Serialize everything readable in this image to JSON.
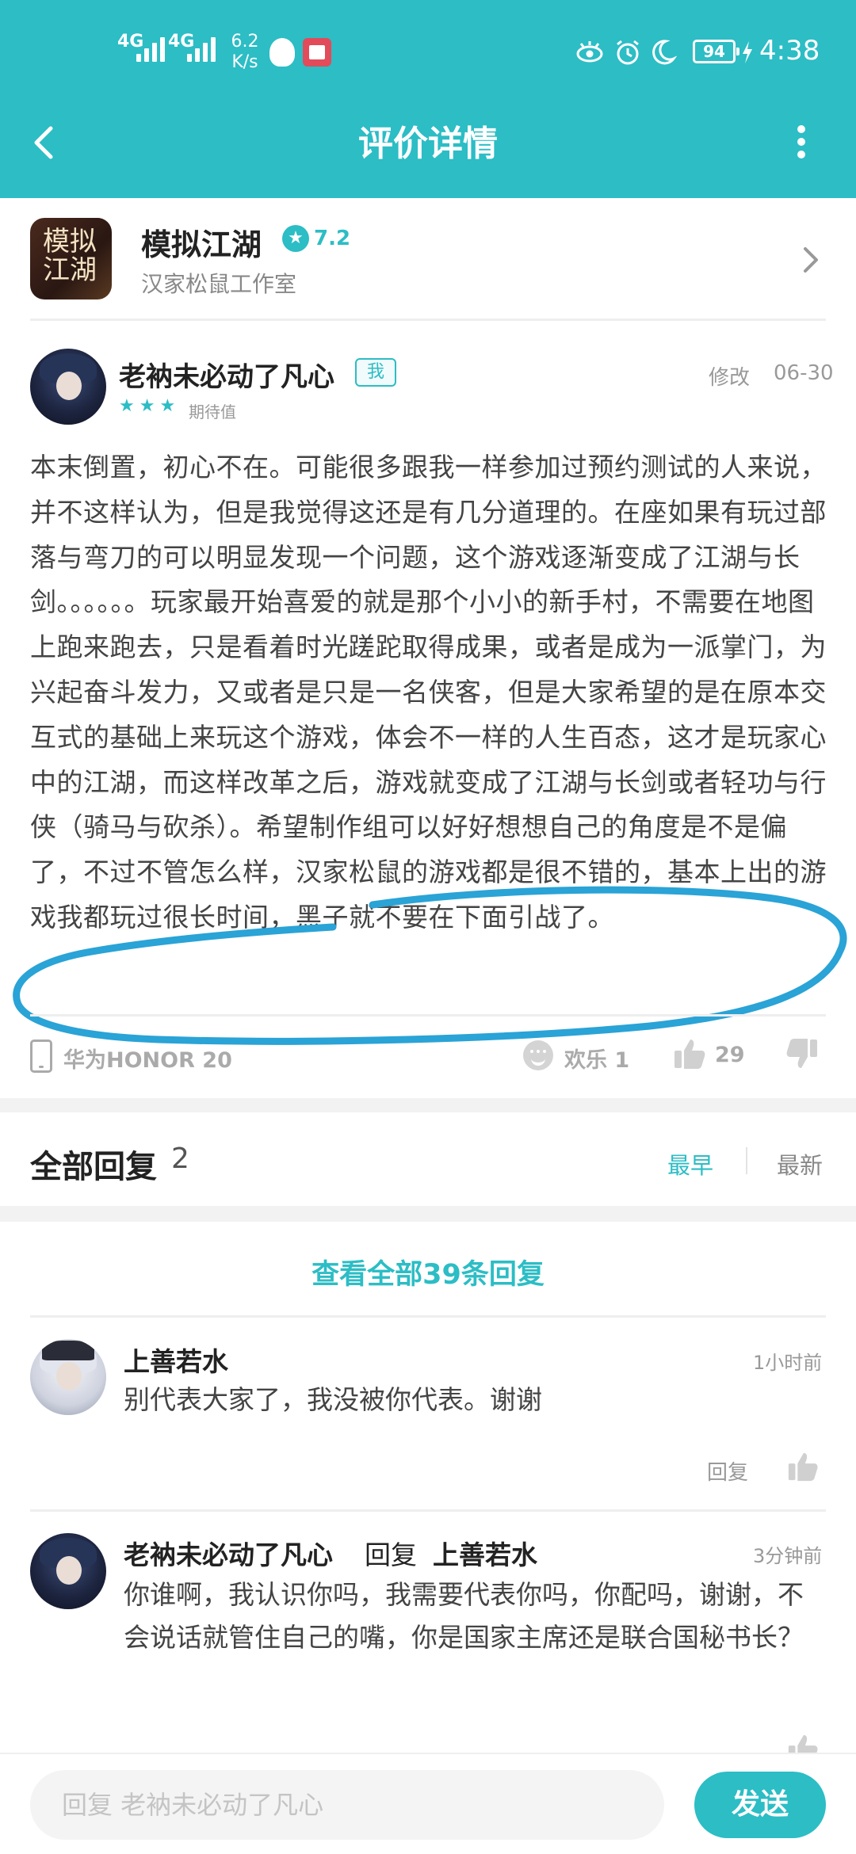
{
  "status_bar": {
    "signal1": "4G",
    "signal2": "4G",
    "speed_value": "6.2",
    "speed_unit": "K/s",
    "battery": "94",
    "time": "4:38"
  },
  "header": {
    "title": "评价详情"
  },
  "game": {
    "icon_text": "模拟江湖",
    "name": "模拟江湖",
    "rating": "7.2",
    "developer": "汉家松鼠工作室"
  },
  "review": {
    "author": "老衲未必动了凡心",
    "me_tag": "我",
    "stars": "★★★",
    "star_label": "期待值",
    "edit_label": "修改",
    "date": "06-30",
    "body": "本末倒置，初心不在。可能很多跟我一样参加过预约测试的人来说，并不这样认为，但是我觉得这还是有几分道理的。在座如果有玩过部落与弯刀的可以明显发现一个问题，这个游戏逐渐变成了江湖与长剑。。。。。。玩家最开始喜爱的就是那个小小的新手村，不需要在地图上跑来跑去，只是看着时光蹉跎取得成果，或者是成为一派掌门，为兴起奋斗发力，又或者是只是一名侠客，但是大家希望的是在原本交互式的基础上来玩这个游戏，体会不一样的人生百态，这才是玩家心中的江湖，而这样改革之后，游戏就变成了江湖与长剑或者轻功与行侠（骑马与砍杀）。希望制作组可以好好想想自己的角度是不是偏了，不过不管怎么样，汉家松鼠的游戏都是很不错的，基本上出的游戏我都玩过很长时间，黑子就不要在下面引战了。",
    "device": "华为HONOR 20",
    "emoji_label": "欢乐 1",
    "likes": "29"
  },
  "replies": {
    "title": "全部回复",
    "count": "2",
    "sort_earliest": "最早",
    "sort_latest": "最新",
    "view_all": "查看全部39条回复",
    "items": [
      {
        "author": "上善若水",
        "time": "1小时前",
        "text": "别代表大家了，我没被你代表。谢谢",
        "reply_label": "回复"
      },
      {
        "author": "老衲未必动了凡心",
        "reply_word": "回复",
        "reply_to": "上善若水",
        "time": "3分钟前",
        "text": "你谁啊，我认识你吗，我需要代表你吗，你配吗，谢谢，不会说话就管住自己的嘴，你是国家主席还是联合国秘书长？"
      }
    ]
  },
  "composer": {
    "placeholder": "回复 老衲未必动了凡心",
    "send_label": "发送"
  },
  "colors": {
    "accent": "#2cbdc5",
    "highlight_stroke": "#2aa3d6"
  }
}
